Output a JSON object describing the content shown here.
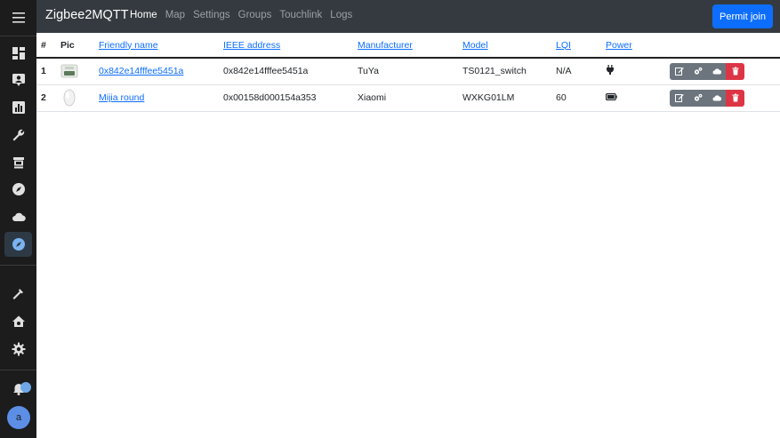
{
  "app": {
    "brand": "Zigbee2MQTT",
    "nav": [
      {
        "label": "Home",
        "active": true
      },
      {
        "label": "Map",
        "active": false
      },
      {
        "label": "Settings",
        "active": false
      },
      {
        "label": "Groups",
        "active": false
      },
      {
        "label": "Touchlink",
        "active": false
      },
      {
        "label": "Logs",
        "active": false
      }
    ],
    "permit_join_label": "Permit join"
  },
  "sidebar": {
    "icons": [
      "menu-icon",
      "dashboard-icon",
      "person-card-icon",
      "chart-icon",
      "wrench-icon",
      "hacs-icon",
      "compass-icon",
      "cloud-icon",
      "zigbee-compass-icon",
      "hammer-icon",
      "home-gear-icon",
      "gear-icon",
      "bell-icon"
    ],
    "avatar_initial": "a",
    "colors": {
      "background": "#1c1c1c",
      "active": "#2d3a45",
      "icon": "#e0e0e0"
    }
  },
  "table": {
    "headers": {
      "num": "#",
      "pic": "Pic",
      "friendly_name": "Friendly name",
      "ieee": "IEEE address",
      "manufacturer": "Manufacturer",
      "model": "Model",
      "lqi": "LQI",
      "power": "Power"
    },
    "rows": [
      {
        "num": "1",
        "friendly_name": "0x842e14fffee5451a",
        "ieee": "0x842e14fffee5451a",
        "manufacturer": "TuYa",
        "model": "TS0121_switch",
        "lqi": "N/A",
        "power_icon": "plug-icon"
      },
      {
        "num": "2",
        "friendly_name": "Mijia round",
        "ieee": "0x00158d000154a353",
        "manufacturer": "Xiaomi",
        "model": "WXKG01LM",
        "lqi": "60",
        "power_icon": "battery-icon"
      }
    ]
  },
  "colors": {
    "navbar": "#343a40",
    "primary": "#0d6efd",
    "danger": "#dc3545",
    "secondary": "#6c757d"
  }
}
